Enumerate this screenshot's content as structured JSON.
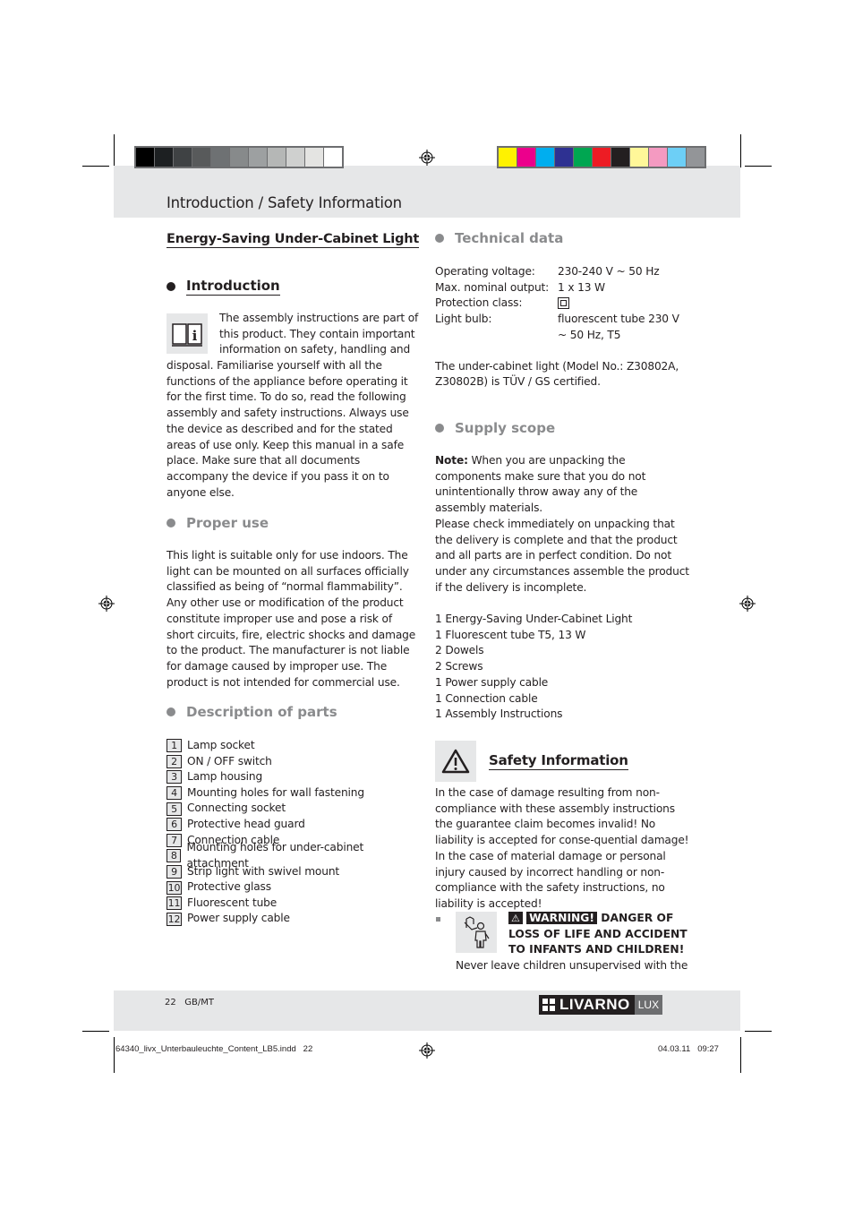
{
  "header": {
    "title": "Introduction / Safety Information"
  },
  "print_marks": {
    "grey_swatches": [
      "#000000",
      "#1d2022",
      "#3f4244",
      "#585a5b",
      "#6e7173",
      "#878a8b",
      "#9da0a1",
      "#b5b7b6",
      "#cfd0cf",
      "#e4e4e2",
      "#ffffff"
    ],
    "color_swatches": [
      "#fff200",
      "#ec008c",
      "#00aeef",
      "#2e3192",
      "#00a651",
      "#ed1c24",
      "#231f20",
      "#fff799",
      "#f49ac1",
      "#6dcff6",
      "#939598"
    ]
  },
  "left": {
    "doc_title": "Energy-Saving Under-Cabinet Light",
    "introduction": {
      "heading": "Introduction",
      "icon": "manual-info-icon",
      "text_wrapped": [
        "The assembly instructions are part of",
        "this product. They contain important",
        "information on safety, handling and"
      ],
      "text_rest": "disposal. Familiarise yourself with all the functions of the appliance before operating it for the first time. To do so, read the following assembly and safety instructions. Always use the device as described and for the stated areas of use only. Keep this manual in a safe place. Make sure that all documents accompany the device if you pass it on to anyone else."
    },
    "proper_use": {
      "heading": "Proper use",
      "text": "This light is suitable only for use indoors. The light can be mounted on all surfaces officially classified as being of “normal flammability”. Any other use or modification of the product constitute improper use and pose a risk of short circuits, fire, electric shocks and damage to the product. The manufacturer is not liable for damage caused by improper use. The product is not intended for commercial use."
    },
    "description_of_parts": {
      "heading": "Description of parts",
      "items": [
        {
          "num": "1",
          "label": "Lamp socket"
        },
        {
          "num": "2",
          "label": "ON / OFF switch"
        },
        {
          "num": "3",
          "label": "Lamp housing"
        },
        {
          "num": "4",
          "label": "Mounting holes for wall fastening"
        },
        {
          "num": "5",
          "label": "Connecting socket"
        },
        {
          "num": "6",
          "label": "Protective head guard"
        },
        {
          "num": "7",
          "label": "Connection cable"
        },
        {
          "num": "8",
          "label": "Mounting holes for under-cabinet attachment"
        },
        {
          "num": "9",
          "label": "Strip light with swivel mount"
        },
        {
          "num": "10",
          "label": "Protective glass"
        },
        {
          "num": "11",
          "label": "Fluorescent tube"
        },
        {
          "num": "12",
          "label": "Power supply cable"
        }
      ]
    }
  },
  "right": {
    "technical_data": {
      "heading": "Technical data",
      "rows": [
        {
          "key": "Operating voltage:",
          "value": "230-240 V ~ 50 Hz"
        },
        {
          "key": "Max. nominal output:",
          "value": "1 x 13 W"
        },
        {
          "key": "Protection class:",
          "value": "",
          "icon": "protection-class-ii-icon"
        },
        {
          "key": "Light bulb:",
          "value": "fluorescent tube 230 V ~ 50 Hz, T5"
        }
      ],
      "certification": "The under-cabinet light (Model No.: Z30802A, Z30802B) is TÜV / GS certified."
    },
    "supply_scope": {
      "heading": "Supply scope",
      "note_label": "Note:",
      "note_text": " When you are unpacking the components make sure that you do not unintentionally throw away any of the assembly materials.",
      "check_text": "Please check immediately on unpacking that the delivery is complete and that the product and all parts are in perfect condition. Do not under any circumstances assemble the product if the delivery is incomplete.",
      "items": [
        "1 Energy-Saving Under-Cabinet Light",
        "1 Fluorescent tube T5, 13 W",
        "2 Dowels",
        "2 Screws",
        "1 Power supply cable",
        "1 Connection cable",
        "1 Assembly Instructions"
      ]
    },
    "safety": {
      "heading": "Safety Information",
      "icon": "warning-triangle-icon",
      "text": "In the case of damage resulting from non-compliance with these assembly instructions the guarantee claim becomes invalid! No liability is accepted for conse-quential damage! In the case of material damage or personal injury caused by incorrect handling or non-compliance with the safety instructions, no liability is accepted!",
      "warning": {
        "icon": "child-hazard-icon",
        "label": "WARNING!",
        "line1": " DANGER OF",
        "line2": "LOSS OF LIFE AND ACCIDENT",
        "line3": "TO INFANTS AND CHILDREN!",
        "body": "Never leave children unsupervised with the"
      }
    }
  },
  "footer": {
    "page": "22",
    "locale": "GB/MT",
    "brand": "LIVARNO",
    "brand_sub": "LUX",
    "slug_file": "64340_livx_Unterbauleuchte_Content_LB5.indd   22",
    "slug_date": "04.03.11   09:27"
  }
}
